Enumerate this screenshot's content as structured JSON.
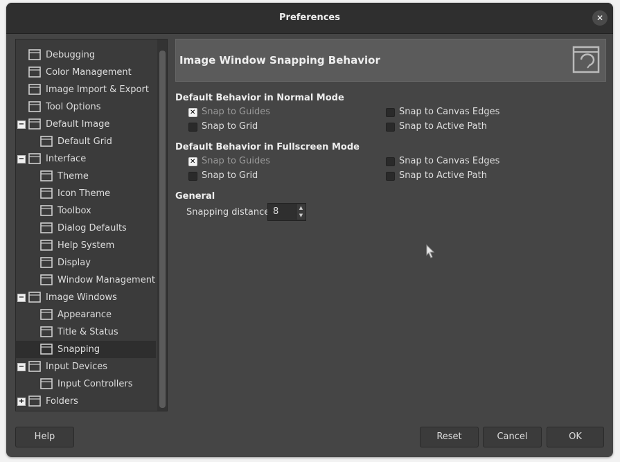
{
  "window": {
    "title": "Preferences",
    "close_label": "✕"
  },
  "sidebar": {
    "items": [
      {
        "label": "Debugging",
        "icon": "debug-icon",
        "level": 0
      },
      {
        "label": "Color Management",
        "icon": "color-management-icon",
        "level": 0
      },
      {
        "label": "Image Import & Export",
        "icon": "import-export-icon",
        "level": 0
      },
      {
        "label": "Tool Options",
        "icon": "tool-options-icon",
        "level": 0
      },
      {
        "label": "Default Image",
        "icon": "default-image-icon",
        "level": 0,
        "expander": "−"
      },
      {
        "label": "Default Grid",
        "icon": "grid-icon",
        "level": 1
      },
      {
        "label": "Interface",
        "icon": "interface-icon",
        "level": 0,
        "expander": "−"
      },
      {
        "label": "Theme",
        "icon": "theme-icon",
        "level": 1
      },
      {
        "label": "Icon Theme",
        "icon": "icon-theme-icon",
        "level": 1
      },
      {
        "label": "Toolbox",
        "icon": "toolbox-icon",
        "level": 1
      },
      {
        "label": "Dialog Defaults",
        "icon": "dialog-defaults-icon",
        "level": 1
      },
      {
        "label": "Help System",
        "icon": "lifebuoy-icon",
        "level": 1
      },
      {
        "label": "Display",
        "icon": "display-icon",
        "level": 1
      },
      {
        "label": "Window Management",
        "icon": "window-management-icon",
        "level": 1
      },
      {
        "label": "Image Windows",
        "icon": "image-windows-icon",
        "level": 0,
        "expander": "−"
      },
      {
        "label": "Appearance",
        "icon": "appearance-icon",
        "level": 1
      },
      {
        "label": "Title & Status",
        "icon": "title-status-icon",
        "level": 1
      },
      {
        "label": "Snapping",
        "icon": "snapping-icon",
        "level": 1,
        "selected": true
      },
      {
        "label": "Input Devices",
        "icon": "input-devices-icon",
        "level": 0,
        "expander": "−"
      },
      {
        "label": "Input Controllers",
        "icon": "input-controllers-icon",
        "level": 1
      },
      {
        "label": "Folders",
        "icon": "folders-icon",
        "level": 0,
        "expander": "+"
      }
    ]
  },
  "page": {
    "title": "Image Window Snapping Behavior",
    "normal": {
      "heading": "Default Behavior in Normal Mode",
      "snap_guides": "Snap to Guides",
      "snap_grid": "Snap to Grid",
      "snap_canvas": "Snap to Canvas Edges",
      "snap_path": "Snap to Active Path"
    },
    "fullscreen": {
      "heading": "Default Behavior in Fullscreen Mode",
      "snap_guides": "Snap to Guides",
      "snap_grid": "Snap to Grid",
      "snap_canvas": "Snap to Canvas Edges",
      "snap_path": "Snap to Active Path"
    },
    "general": {
      "heading": "General",
      "distance_label": "Snapping distance:",
      "distance_value": "8"
    }
  },
  "buttons": {
    "help": "Help",
    "reset": "Reset",
    "cancel": "Cancel",
    "ok": "OK"
  },
  "colors": {
    "background": "#454545",
    "titlebar": "#2f2f2f",
    "selected_row": "#2e2e2e"
  }
}
